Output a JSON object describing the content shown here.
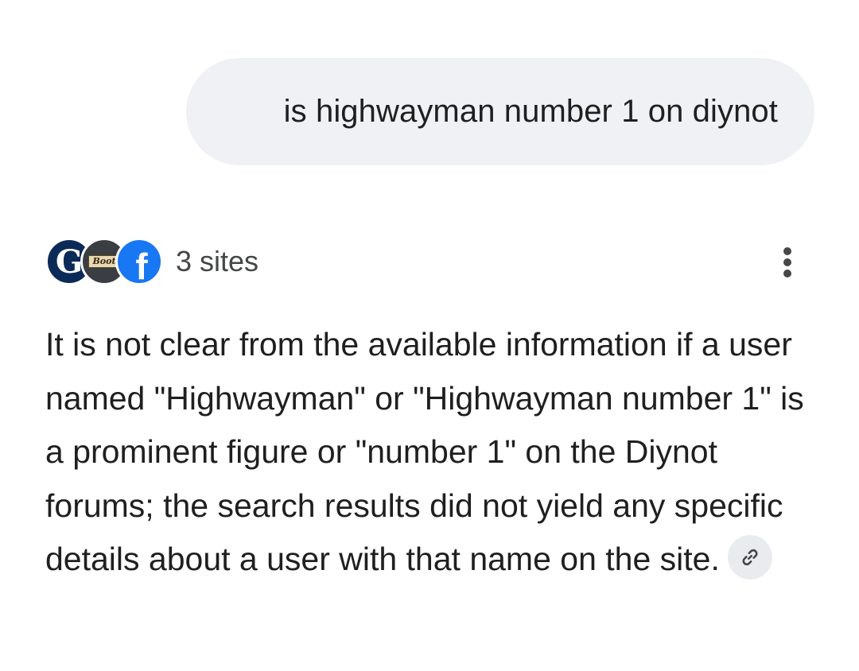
{
  "user_message": {
    "text": "is highwayman number 1 on diynot"
  },
  "sources": {
    "label": "3 sites",
    "favicons": [
      {
        "icon": "guardian-favicon",
        "glyph": "G",
        "color": "#0b2a57"
      },
      {
        "icon": "boot-favicon",
        "glyph": "Boot",
        "color": "#3a3d42"
      },
      {
        "icon": "facebook-favicon",
        "glyph": "f",
        "color": "#1877f2"
      }
    ]
  },
  "menu": {
    "icon": "more-vert-icon"
  },
  "answer": {
    "text": "It is not clear from the available information if a user named \"Highwayman\" or \"Highwayman number 1\" is a prominent figure or \"number 1\" on the Diynot forums; the search results did not yield any specific details about a user with that name on the site.",
    "link_icon": "link-icon"
  },
  "colors": {
    "bubble_bg": "#f0f1f5",
    "text_primary": "#1f1f1f",
    "text_secondary": "#444746",
    "chip_bg": "#e9ebef"
  }
}
